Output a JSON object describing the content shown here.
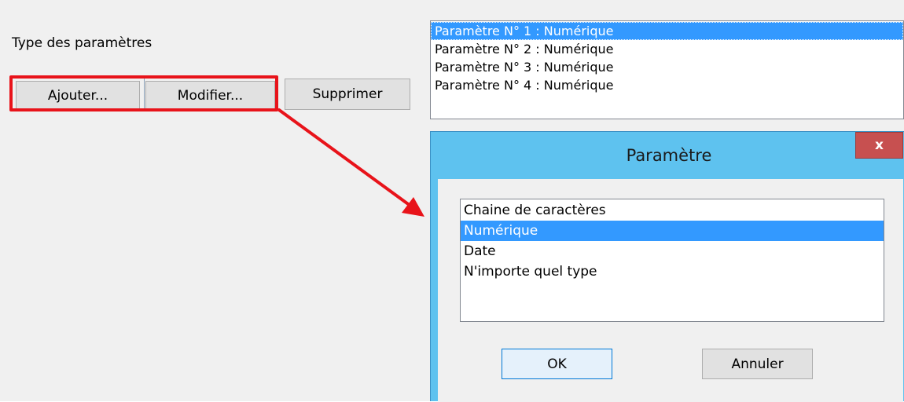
{
  "parent": {
    "label": "Type des paramètres",
    "buttons": {
      "add": "Ajouter...",
      "edit": "Modifier...",
      "delete": "Supprimer"
    },
    "parameters": [
      "Paramètre N° 1 : Numérique",
      "Paramètre N° 2 : Numérique",
      "Paramètre N° 3 : Numérique",
      "Paramètre N° 4 : Numérique"
    ],
    "selected_parameter": "Paramètre N° 1 : Numérique"
  },
  "dialog": {
    "title": "Paramètre",
    "close_label": "x",
    "types": [
      "Chaine de caractères",
      "Numérique",
      "Date",
      "N'importe quel type"
    ],
    "selected_type": "Numérique",
    "ok_label": "OK",
    "cancel_label": "Annuler"
  },
  "annotation": {
    "highlight_color": "#e8131a",
    "arrow_color": "#e8131a"
  },
  "colors": {
    "selection": "#3399ff",
    "dialog_frame": "#5ec2ef",
    "close_button": "#c75050"
  }
}
